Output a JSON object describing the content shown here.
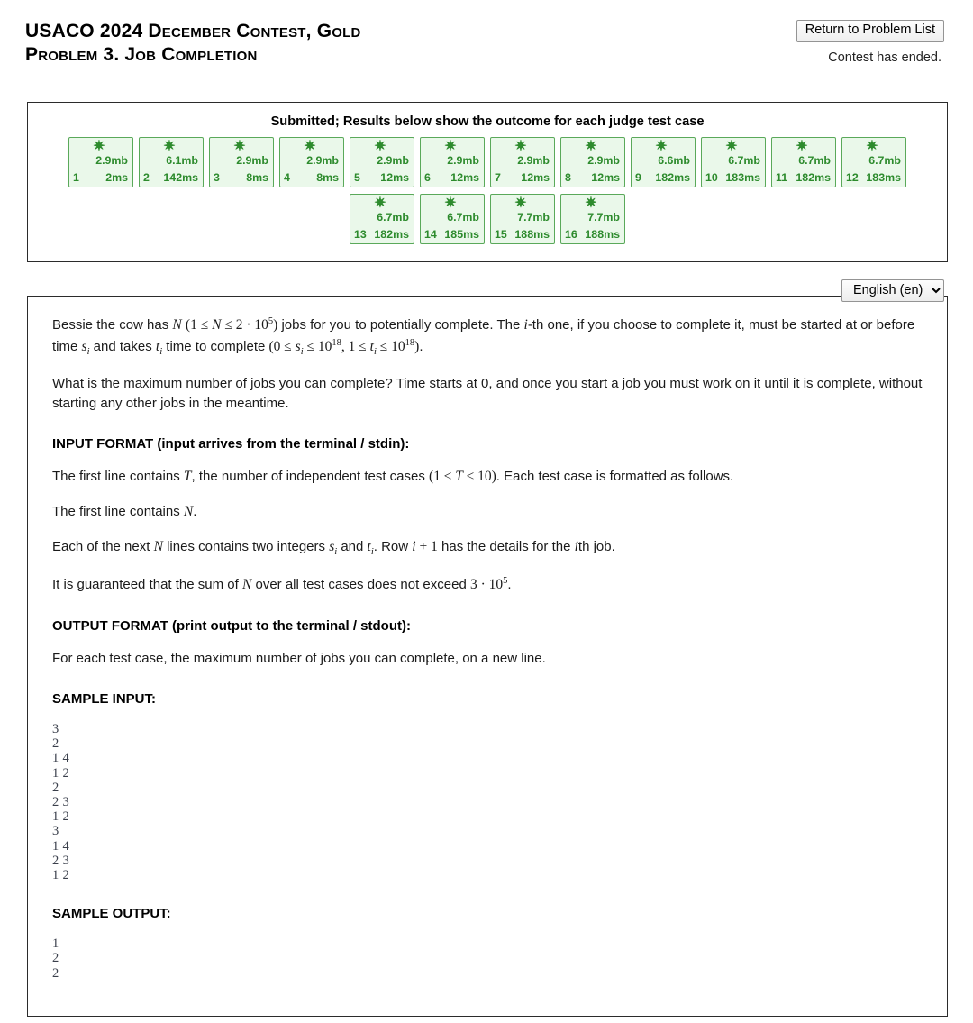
{
  "header": {
    "title_line1": "USACO 2024 December Contest, Gold",
    "title_line2": "Problem 3. Job Completion",
    "return_button": "Return to Problem List",
    "contest_status": "Contest has ended."
  },
  "results": {
    "heading": "Submitted; Results below show the outcome for each judge test case",
    "star_glyph": "✷",
    "colors": {
      "border": "#5aa95a",
      "background": "#eaf8ea",
      "text": "#2d8b2d"
    },
    "cases": [
      {
        "index": "1",
        "memory": "2.9mb",
        "time": "2ms"
      },
      {
        "index": "2",
        "memory": "6.1mb",
        "time": "142ms"
      },
      {
        "index": "3",
        "memory": "2.9mb",
        "time": "8ms"
      },
      {
        "index": "4",
        "memory": "2.9mb",
        "time": "8ms"
      },
      {
        "index": "5",
        "memory": "2.9mb",
        "time": "12ms"
      },
      {
        "index": "6",
        "memory": "2.9mb",
        "time": "12ms"
      },
      {
        "index": "7",
        "memory": "2.9mb",
        "time": "12ms"
      },
      {
        "index": "8",
        "memory": "2.9mb",
        "time": "12ms"
      },
      {
        "index": "9",
        "memory": "6.6mb",
        "time": "182ms"
      },
      {
        "index": "10",
        "memory": "6.7mb",
        "time": "183ms"
      },
      {
        "index": "11",
        "memory": "6.7mb",
        "time": "182ms"
      },
      {
        "index": "12",
        "memory": "6.7mb",
        "time": "183ms"
      },
      {
        "index": "13",
        "memory": "6.7mb",
        "time": "182ms"
      },
      {
        "index": "14",
        "memory": "6.7mb",
        "time": "185ms"
      },
      {
        "index": "15",
        "memory": "7.7mb",
        "time": "188ms"
      },
      {
        "index": "16",
        "memory": "7.7mb",
        "time": "188ms"
      }
    ]
  },
  "language": {
    "selected": "English (en)",
    "options": [
      "English (en)"
    ]
  },
  "problem": {
    "intro_a": "Bessie the cow has ",
    "intro_b": " jobs for you to potentially complete. The ",
    "intro_c": "-th one, if you choose to complete it, must be started at or before time ",
    "intro_d": " and takes ",
    "intro_e": " time to complete ",
    "intro_f": ".",
    "paragraph2": "What is the maximum number of jobs you can complete? Time starts at 0, and once you start a job you must work on it until it is complete, without starting any other jobs in the meantime.",
    "input_format_heading": "INPUT FORMAT (input arrives from the terminal / stdin):",
    "input_line1_a": "The first line contains ",
    "input_line1_b": ", the number of independent test cases ",
    "input_line1_c": ". Each test case is formatted as follows.",
    "input_line2_a": "The first line contains ",
    "input_line2_b": ".",
    "input_line3_a": "Each of the next ",
    "input_line3_b": " lines contains two integers ",
    "input_line3_c": " and ",
    "input_line3_d": ". Row ",
    "input_line3_e": " has the details for the ",
    "input_line3_f": "th job.",
    "input_line4_a": "It is guaranteed that the sum of ",
    "input_line4_b": " over all test cases does not exceed ",
    "input_line4_c": ".",
    "output_format_heading": "OUTPUT FORMAT (print output to the terminal / stdout):",
    "output_text": "For each test case, the maximum number of jobs you can complete, on a new line.",
    "sample_input_heading": "SAMPLE INPUT:",
    "sample_input": "3\n2\n1 4\n1 2\n2\n2 3\n1 2\n3\n1 4\n2 3\n1 2",
    "sample_output_heading": "SAMPLE OUTPUT:",
    "sample_output": "1\n2\n2"
  }
}
